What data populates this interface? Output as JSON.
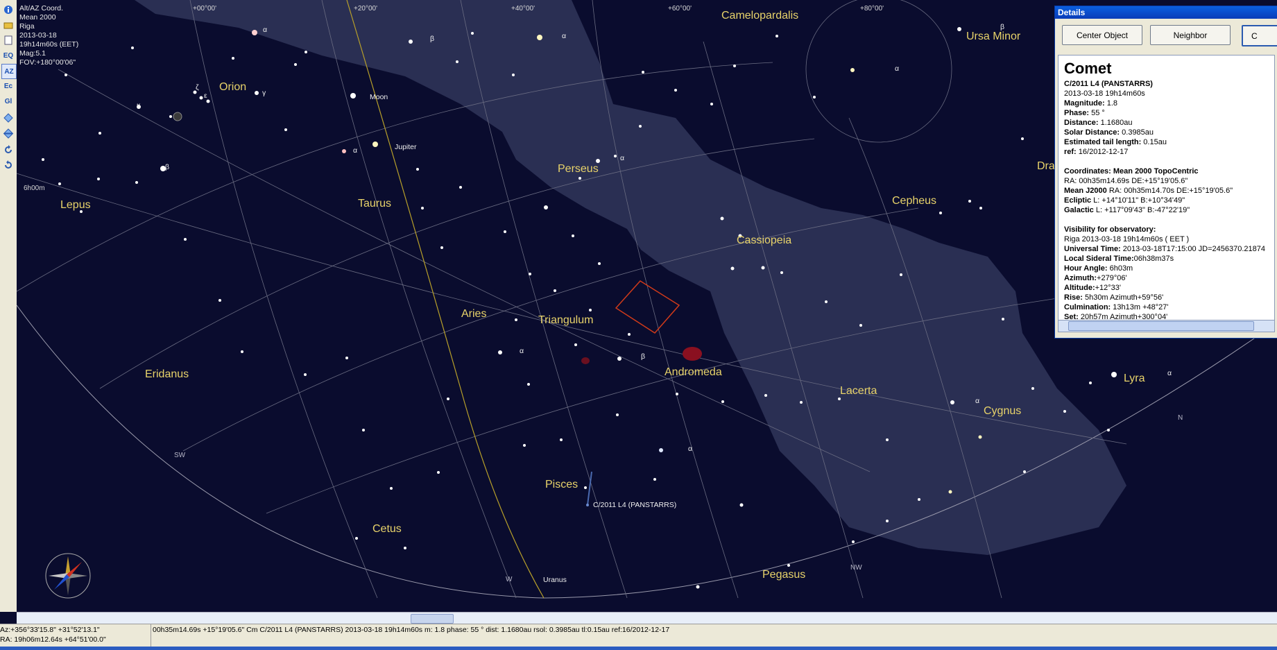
{
  "info_overlay": {
    "projection": "Alt/AZ Coord.",
    "equinox": "Mean 2000",
    "observatory": "Riga",
    "date": "2013-03-18",
    "time": "19h14m60s (EET)",
    "magnitude": "Mag:5.1",
    "fov": "FOV:+180°00'06\""
  },
  "toolbar": {
    "eq_label": "EQ",
    "az_label": "AZ",
    "ec_label": "Ec",
    "gl_label": "Gl"
  },
  "grid_labels": {
    "ra_0": "+00°00'",
    "ra_20": "+20°00'",
    "ra_40": "+40°00'",
    "ra_60": "+60°00'",
    "ra_80": "+80°00'",
    "hour_6": "6h00m"
  },
  "constellations": {
    "camelopardalis": "Camelopardalis",
    "ursa_minor": "Ursa Minor",
    "orion": "Orion",
    "lepus": "Lepus",
    "taurus": "Taurus",
    "perseus": "Perseus",
    "cepheus": "Cepheus",
    "cassiopeia": "Cassiopeia",
    "aries": "Aries",
    "triangulum": "Triangulum",
    "eridanus": "Eridanus",
    "andromeda": "Andromeda",
    "lacerta": "Lacerta",
    "cygnus": "Cygnus",
    "lyra": "Lyra",
    "pisces": "Pisces",
    "cetus": "Cetus",
    "pegasus": "Pegasus",
    "draco_partial": "Dra"
  },
  "objects": {
    "moon": "Moon",
    "jupiter": "Jupiter",
    "uranus": "Uranus",
    "comet": "C/2011 L4 (PANSTARRS)"
  },
  "greek": {
    "alpha": "α",
    "beta": "β",
    "gamma": "γ",
    "zeta": "ζ",
    "epsilon": "ε",
    "kappa": "κ"
  },
  "directions": {
    "sw": "SW",
    "w": "W",
    "nw": "NW",
    "n": "N"
  },
  "details": {
    "title": "Details",
    "center_button": "Center Object",
    "neighbor_button": "Neighbor",
    "third_button_partial": "C",
    "heading": "Comet",
    "name": "C/2011 L4 (PANSTARRS)",
    "datetime": "2013-03-18 19h14m60s",
    "magnitude_key": "Magnitude:",
    "magnitude_val": " 1.8",
    "phase_key": "Phase:",
    "phase_val": " 55 °",
    "distance_key": "Distance:",
    "distance_val": " 1.1680au",
    "solar_key": "Solar Distance:",
    "solar_val": " 0.3985au",
    "tail_key": "Estimated tail length:",
    "tail_val": " 0.15au",
    "ref_key": "ref:",
    "ref_val": " 16/2012-12-17",
    "coords_header": "Coordinates: Mean 2000 TopoCentric",
    "ra_line": "RA: 00h35m14.69s DE:+15°19'05.6\"",
    "j2000_key": "Mean J2000",
    "j2000_val": " RA: 00h35m14.70s DE:+15°19'05.6\"",
    "ecliptic_key": "Ecliptic",
    "ecliptic_val": "  L: +14°10'11\" B:+10°34'49\"",
    "galactic_key": "Galactic",
    "galactic_val": "  L: +117°09'43\" B:-47°22'19\"",
    "visibility_header": "Visibility for observatory:",
    "obs_line": "Riga 2013-03-18 19h14m60s ( EET )",
    "ut_key": "Universal Time:",
    "ut_val": " 2013-03-18T17:15:00 JD=2456370.21874",
    "lst_key": "Local Sideral Time:",
    "lst_val": "06h38m37s",
    "ha_key": "Hour Angle:",
    "ha_val": " 6h03m",
    "az_key": "Azimuth:",
    "az_val": "+279°06'",
    "alt_key": "Altitude:",
    "alt_val": "+12°33'",
    "rise_key": "Rise:",
    "rise_val": " 5h30m Azimuth+59°56'",
    "culm_key": "Culmination:",
    "culm_val": " 13h13m +48°27'",
    "set_key": "Set:",
    "set_val": " 20h57m Azimuth+300°04'"
  },
  "status": {
    "altaz": "Az:+356°33'15.8\" +31°52'13.1\"",
    "radec": "RA: 19h06m12.64s +64°51'00.0\"",
    "object_info": "00h35m14.69s +15°19'05.6\" Cm C/2011 L4 (PANSTARRS) 2013-03-18 19h14m60s m: 1.8 phase: 55 ° dist: 1.1680au rsol: 0.3985au tl:0.15au ref:16/2012-12-17"
  },
  "colors": {
    "sky": "#0a0c2e",
    "milky_way": "#2e3358",
    "grid": "#8a8a9a",
    "ecliptic": "#b8a02a",
    "constellation_label": "#e8d36a",
    "comet_marker": "#d03a1a"
  }
}
